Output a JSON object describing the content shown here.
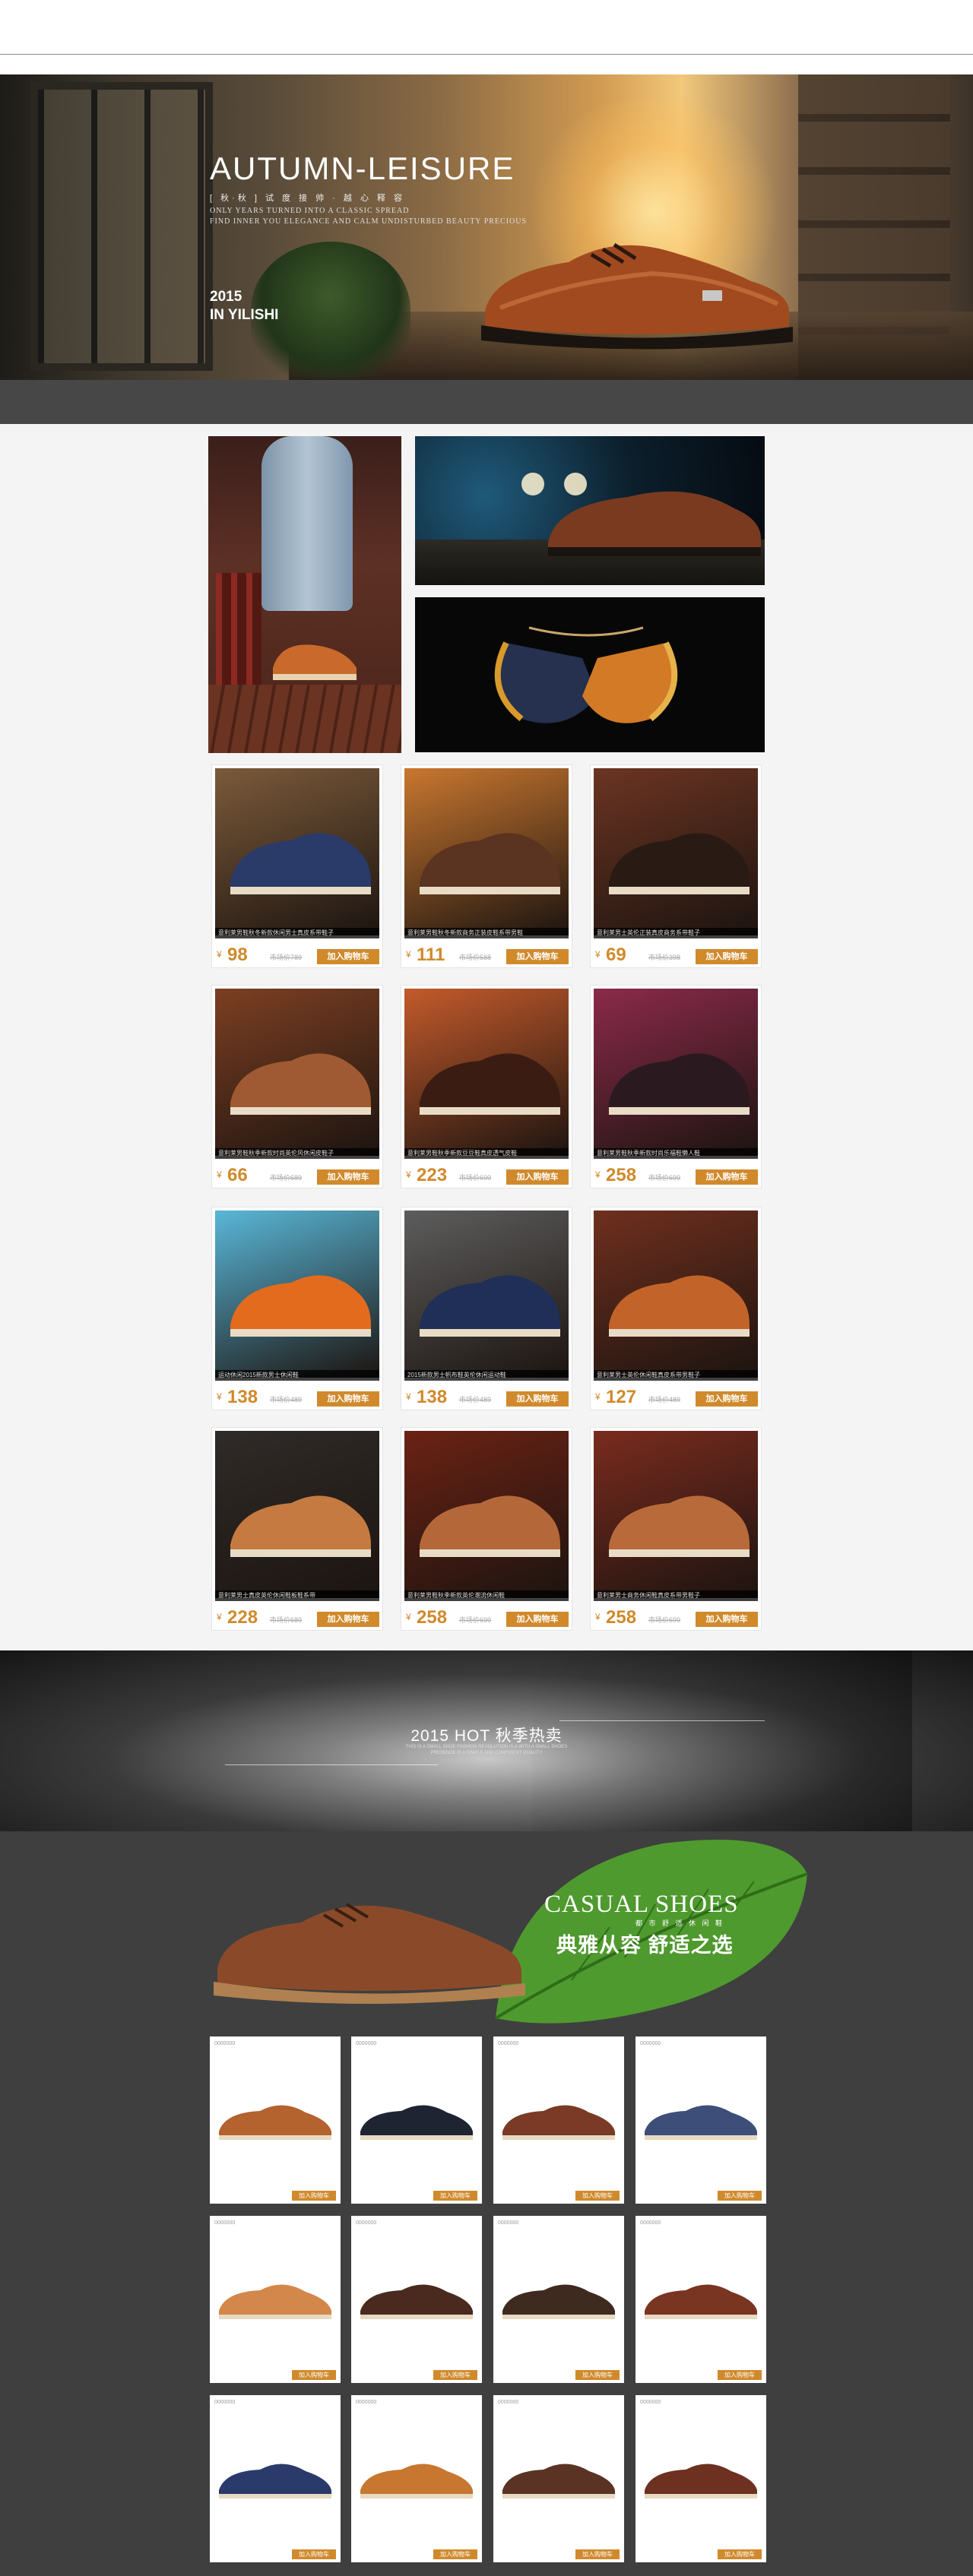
{
  "hero": {
    "title": "AUTUMN-LEISURE",
    "tagline": "[ 秋·秋 ]   试 度 接 帅   ·   越 心 释 容",
    "sub_line1": "ONLY YEARS TURNED INTO A CLASSIC SPREAD",
    "sub_line2": "FIND INNER YOU ELEGANCE AND CALM UNDISTURBED BEAUTY PRECIOUS",
    "year": "2015",
    "brand": "IN YILISHI"
  },
  "products": [
    {
      "caption": "意利莱男鞋秋冬新款休闲男士真皮系带鞋子",
      "price": "98",
      "market": "市场价789"
    },
    {
      "caption": "意利莱男鞋秋冬新款商务正装皮鞋系带男鞋",
      "price": "111",
      "market": "市场价588"
    },
    {
      "caption": "意利莱男士英伦正装真皮商务系带鞋子",
      "price": "69",
      "market": "市场价398"
    },
    {
      "caption": "意利莱男鞋秋季新款时尚英伦风休闲皮鞋子",
      "price": "66",
      "market": "市场价689"
    },
    {
      "caption": "意利莱男鞋秋季新款豆豆鞋真皮透气皮鞋",
      "price": "223",
      "market": "市场价699"
    },
    {
      "caption": "意利莱男鞋秋季新款时尚乐福鞋懒人鞋",
      "price": "258",
      "market": "市场价699"
    },
    {
      "caption": "运动休闲2015新款男士休闲鞋",
      "price": "138",
      "market": "市场价489"
    },
    {
      "caption": "2015新款男士帆布鞋英伦休闲运动鞋",
      "price": "138",
      "market": "市场价489"
    },
    {
      "caption": "意利莱男士英伦休闲鞋真皮系带男鞋子",
      "price": "127",
      "market": "市场价489"
    },
    {
      "caption": "意利莱男士真皮英伦休闲鞋板鞋系带",
      "price": "228",
      "market": "市场价689"
    },
    {
      "caption": "意利莱男鞋秋季新款英伦潮流休闲鞋",
      "price": "258",
      "market": "市场价699"
    },
    {
      "caption": "意利莱男士商务休闲鞋真皮系带男鞋子",
      "price": "258",
      "market": "市场价699"
    }
  ],
  "labels": {
    "yen": "¥",
    "add_to_cart": "加入购物车"
  },
  "band": {
    "title": "2015 HOT 秋季热卖",
    "line1": "THIS IS A SMALL SHOE FASHION REVOLUTION IS A WITH A SMALL SHOES",
    "line2": "PRESENCE IS A SIMPLE AND CONFIDENT QUALITY"
  },
  "casual": {
    "title": "CASUAL SHOES",
    "cn_small": "都 市 舒 适 休 闲 鞋",
    "cn_big": "典雅从容 舒适之选"
  },
  "tiles": [
    {
      "code": "0000000"
    },
    {
      "code": "0000000"
    },
    {
      "code": "0000000"
    },
    {
      "code": "0000000"
    },
    {
      "code": "0000000"
    },
    {
      "code": "0000000"
    },
    {
      "code": "0000000"
    },
    {
      "code": "0000000"
    },
    {
      "code": "0000000"
    },
    {
      "code": "0000000"
    },
    {
      "code": "0000000"
    },
    {
      "code": "0000000"
    }
  ],
  "colors": {
    "accent": "#d08a2c",
    "dark_bg": "#3f3f3f",
    "light_bg": "#f4f4f4"
  }
}
